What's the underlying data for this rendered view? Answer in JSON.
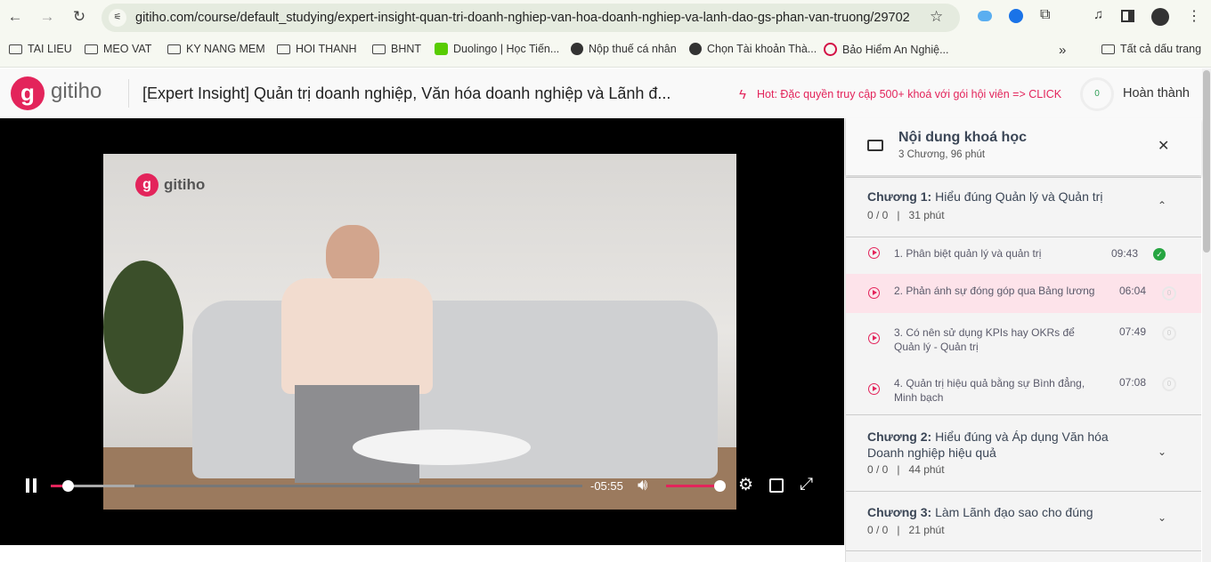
{
  "browser": {
    "url": "gitiho.com/course/default_studying/expert-insight-quan-tri-doanh-nghiep-van-hoa-doanh-nghiep-va-lanh-dao-gs-phan-van-truong/29702",
    "bookmarks": [
      {
        "label": "TAI LIEU",
        "icon": "folder-icon"
      },
      {
        "label": "MEO VAT",
        "icon": "folder-icon"
      },
      {
        "label": "KY NANG MEM",
        "icon": "folder-icon"
      },
      {
        "label": "HOI THANH",
        "icon": "folder-icon"
      },
      {
        "label": "BHNT",
        "icon": "folder-icon"
      },
      {
        "label": "Duolingo | Học Tiến...",
        "icon": "duolingo-icon"
      },
      {
        "label": "Nộp thuế cá nhân",
        "icon": "globe-icon"
      },
      {
        "label": "Chọn Tài khoản Thà...",
        "icon": "globe-icon"
      },
      {
        "label": "Bảo Hiểm An Nghiệ...",
        "icon": "aia-icon"
      }
    ],
    "overflow": "»",
    "all_bookmarks": "Tất cả dấu trang"
  },
  "header": {
    "logo": "gitiho",
    "title": "[Expert Insight] Quản trị doanh nghiệp, Văn hóa doanh nghiệp và Lãnh đ...",
    "hot": "Hot: Đặc quyền truy cập 500+ khoá với gói hội viên => CLICK",
    "progress": "0",
    "complete": "Hoàn thành",
    "hot_color": "#e3245b"
  },
  "player": {
    "watermark": "gitiho",
    "time_remaining": "-05:55",
    "progress": 0.03,
    "volume": 1.0
  },
  "sidebar": {
    "title": "Nội dung khoá học",
    "subtitle": "3 Chương, 96 phút",
    "chapters": [
      {
        "prefix": "Chương 1:",
        "name": "Hiểu đúng Quản lý và Quản trị",
        "progress": "0 / 0",
        "sep": "|",
        "duration": "31 phút",
        "lessons": [
          {
            "title": "1. Phân biệt quản lý và quản trị",
            "time": "09:43",
            "status": "done"
          },
          {
            "title": "2. Phản ánh sự đóng góp qua Bảng lương",
            "time": "06:04",
            "status": "0"
          },
          {
            "title": "3. Có nên sử dụng KPIs hay OKRs để Quản lý - Quản trị",
            "time": "07:49",
            "status": "0"
          },
          {
            "title": "4. Quản trị hiệu quả bằng sự Bình đẳng, Minh bạch",
            "time": "07:08",
            "status": "0"
          }
        ]
      },
      {
        "prefix": "Chương 2:",
        "name": "Hiểu đúng và Áp dụng Văn hóa Doanh nghiệp hiệu quả",
        "progress": "0 / 0",
        "sep": "|",
        "duration": "44 phút"
      },
      {
        "prefix": "Chương 3:",
        "name": "Làm Lãnh đạo sao cho đúng",
        "progress": "0 / 0",
        "sep": "|",
        "duration": "21 phút"
      }
    ]
  }
}
